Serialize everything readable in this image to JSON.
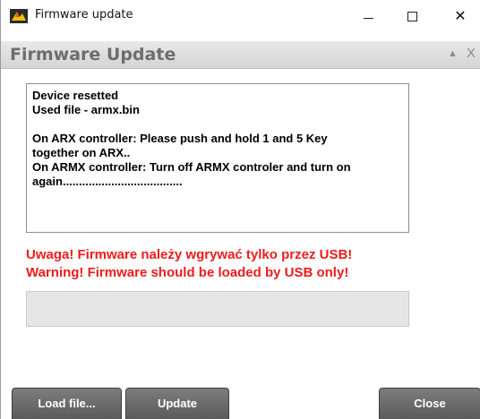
{
  "window": {
    "title": "Firmware update",
    "minimize_label": "",
    "maximize_label": "",
    "close_label": "✕"
  },
  "panel": {
    "title": "Firmware Update",
    "collapse_glyph": "▲",
    "close_glyph": "X"
  },
  "log": {
    "lines": [
      "Device resetted",
      "Used file - armx.bin",
      "",
      "On ARX controller: Please push and hold 1 and 5 Key",
      "together on ARX..",
      "On ARMX controller: Turn off ARMX controler and turn on",
      "again....................................."
    ]
  },
  "warnings": {
    "polish": "Uwaga! Firmware należy wgrywać tylko przez USB!",
    "english": "Warning! Firmware should be loaded by USB only!"
  },
  "progress": {
    "value": 0
  },
  "buttons": {
    "load": "Load file...",
    "update": "Update",
    "close": "Close"
  },
  "colors": {
    "warning": "#ee1c1c",
    "button": "#666666",
    "header_text": "#6d6d6d"
  },
  "icons": {
    "app": "app-logo-icon",
    "collapse": "chevron-up-icon",
    "close": "close-icon"
  }
}
